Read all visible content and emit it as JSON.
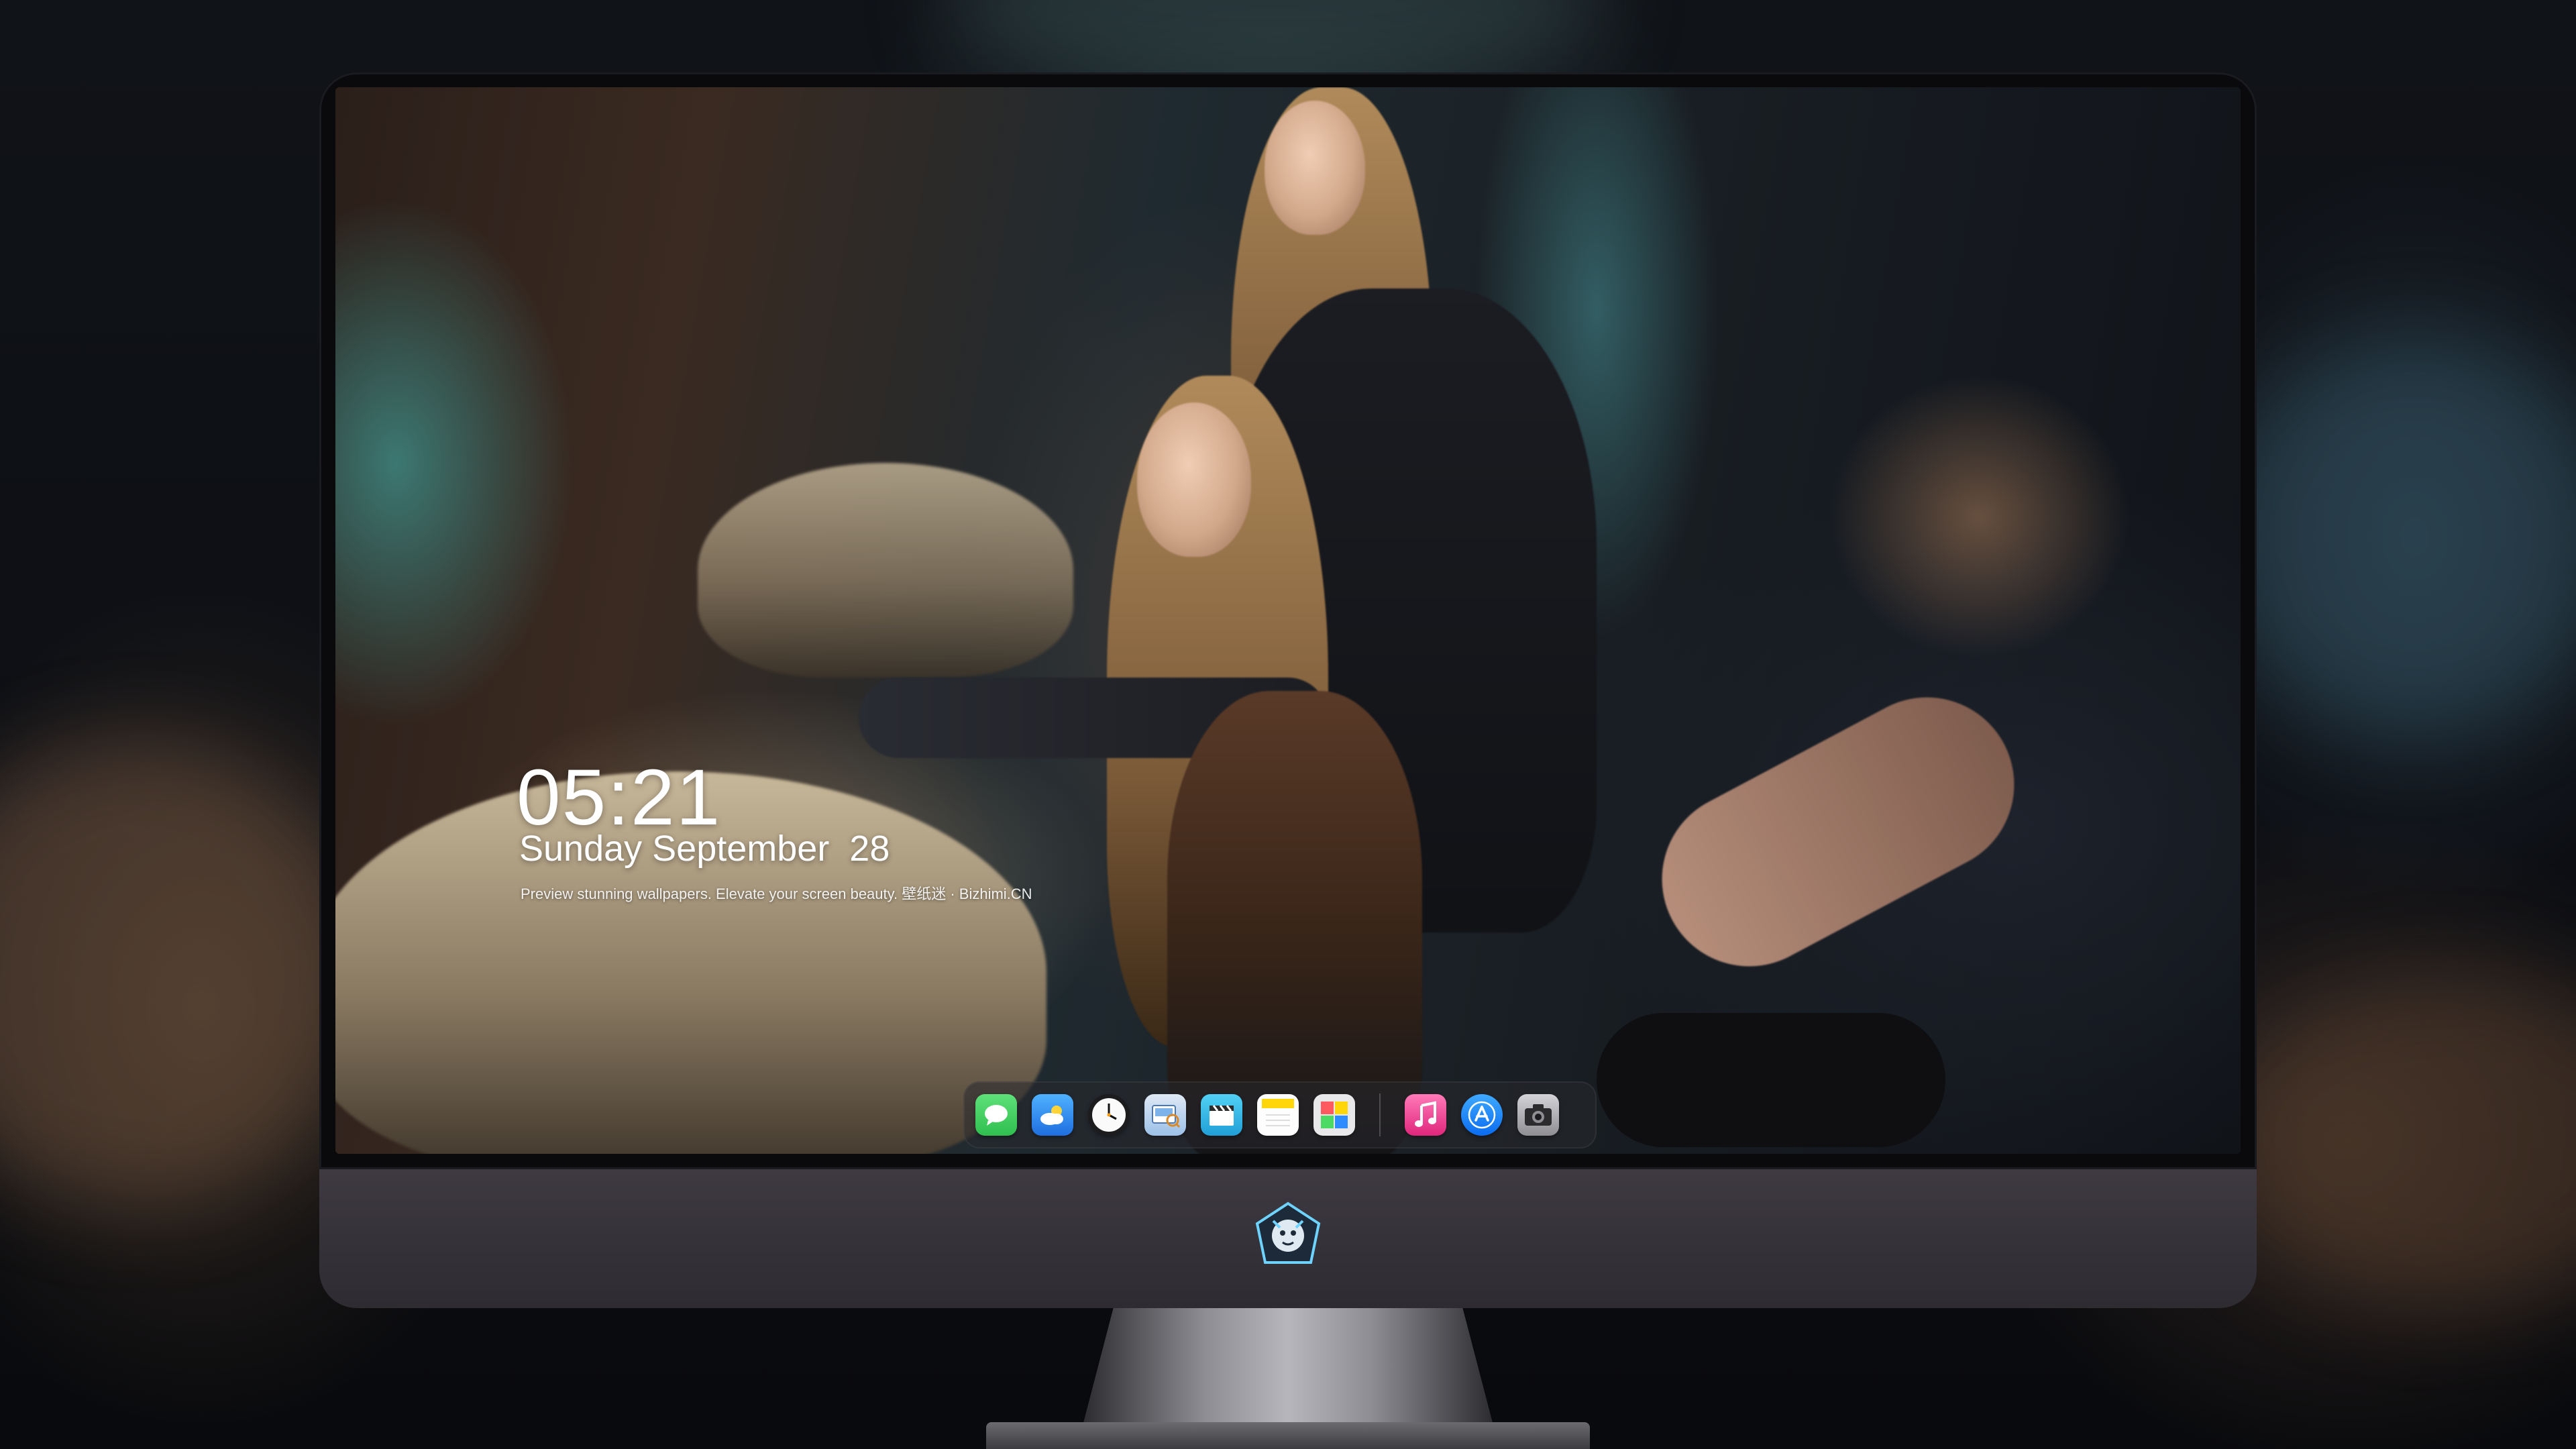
{
  "lock_screen": {
    "time": "05:21",
    "date": "Sunday September  28",
    "tagline": "Preview stunning wallpapers. Elevate your screen beauty. 壁纸迷 · Bizhimi.CN"
  },
  "dock": {
    "apps": [
      {
        "name": "messages",
        "icon": "speech-bubble",
        "color": "#34c759"
      },
      {
        "name": "weather",
        "icon": "cloud-sun",
        "color": "#2f8cff"
      },
      {
        "name": "clock",
        "icon": "clock-face",
        "color": "#f2f2f2"
      },
      {
        "name": "preview",
        "icon": "photos-magnifier",
        "color": "#6fa8e8"
      },
      {
        "name": "clips",
        "icon": "clapperboard",
        "color": "#3ab5e6"
      },
      {
        "name": "notes",
        "icon": "notepad",
        "color": "#ffd60a"
      },
      {
        "name": "photo-booth",
        "icon": "color-grid",
        "color": "#4cd964"
      },
      {
        "name": "music",
        "icon": "music-note",
        "color": "#fc3c8d"
      },
      {
        "name": "app-store",
        "icon": "a-letter",
        "color": "#0a84ff"
      },
      {
        "name": "camera",
        "icon": "camera",
        "color": "#8e8e93"
      }
    ]
  },
  "monitor": {
    "chin_logo": "dragon-emblem-icon"
  }
}
